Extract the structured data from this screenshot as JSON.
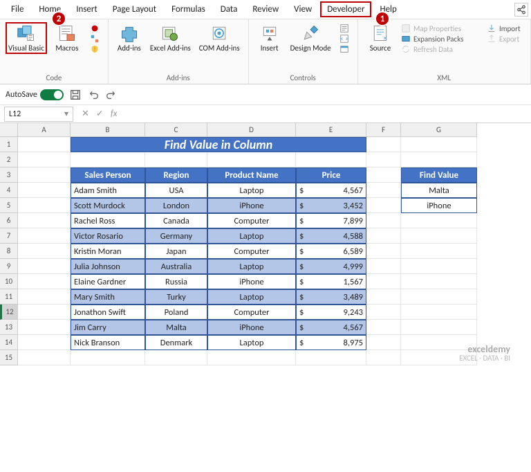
{
  "menu": {
    "file": "File",
    "home": "Home",
    "insert": "Insert",
    "page_layout": "Page Layout",
    "formulas": "Formulas",
    "data": "Data",
    "review": "Review",
    "view": "View",
    "developer": "Developer",
    "help": "Help"
  },
  "badges": {
    "one": "1",
    "two": "2"
  },
  "ribbon": {
    "visual_basic": "Visual Basic",
    "macros": "Macros",
    "code": "Code",
    "addins": "Add-ins",
    "excel_addins": "Excel Add-ins",
    "com_addins": "COM Add-ins",
    "addins_group": "Add-ins",
    "insert": "Insert",
    "design_mode": "Design Mode",
    "controls": "Controls",
    "source": "Source",
    "map_properties": "Map Properties",
    "expansion_packs": "Expansion Packs",
    "refresh_data": "Refresh Data",
    "import": "Import",
    "export": "Export",
    "xml": "XML"
  },
  "qat": {
    "autosave": "AutoSave"
  },
  "namebox": "L12",
  "cols": [
    "A",
    "B",
    "C",
    "D",
    "E",
    "F",
    "G"
  ],
  "title": "Find Value in Column",
  "headers": {
    "sp": "Sales Person",
    "region": "Region",
    "prod": "Product Name",
    "price": "Price",
    "find": "Find Value"
  },
  "find_values": [
    "Malta",
    "iPhone"
  ],
  "rows": [
    {
      "sp": "Adam Smith",
      "region": "USA",
      "prod": "Laptop",
      "price": "4,567"
    },
    {
      "sp": "Scott Murdock",
      "region": "London",
      "prod": "iPhone",
      "price": "3,452"
    },
    {
      "sp": "Rachel Ross",
      "region": "Canada",
      "prod": "Computer",
      "price": "7,899"
    },
    {
      "sp": "Victor Rosario",
      "region": "Germany",
      "prod": "Laptop",
      "price": "4,588"
    },
    {
      "sp": "Kristin Moran",
      "region": "Japan",
      "prod": "Computer",
      "price": "6,589"
    },
    {
      "sp": "Julia Johnson",
      "region": "Australia",
      "prod": "Laptop",
      "price": "4,999"
    },
    {
      "sp": "Elaine Gardner",
      "region": "Russia",
      "prod": "iPhone",
      "price": "1,567"
    },
    {
      "sp": "Mary Smith",
      "region": "Turky",
      "prod": "Laptop",
      "price": "3,489"
    },
    {
      "sp": "Jonathon Swift",
      "region": "Poland",
      "prod": "Computer",
      "price": "9,243"
    },
    {
      "sp": "Jim Carry",
      "region": "Malta",
      "prod": "iPhone",
      "price": "4,567"
    },
    {
      "sp": "Nick Branson",
      "region": "Denmark",
      "prod": "Laptop",
      "price": "8,975"
    }
  ],
  "currency": "$",
  "watermark": {
    "name": "exceldemy",
    "tag": "EXCEL · DATA · BI"
  }
}
